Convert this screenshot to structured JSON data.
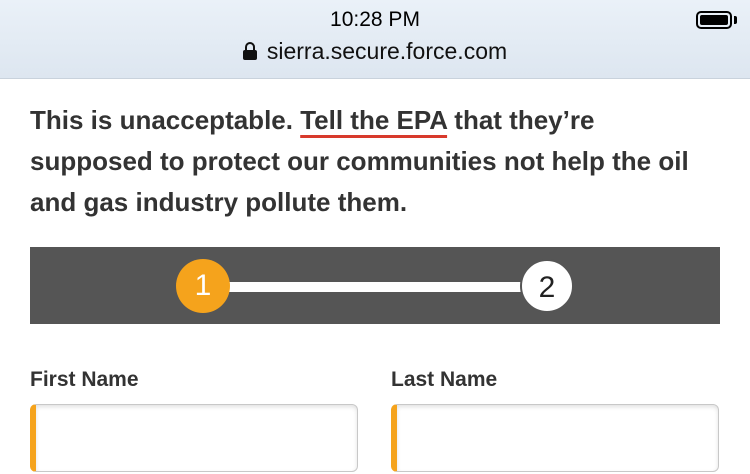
{
  "status_bar": {
    "time": "10:28 PM",
    "url": "sierra.secure.force.com",
    "battery_level": 1.0
  },
  "message": {
    "intro": "This is unacceptable. ",
    "link_text": "Tell the EPA",
    "rest": " that they’re supposed to protect our communities not help the oil and gas industry pollute them."
  },
  "stepper": {
    "steps": [
      "1",
      "2"
    ],
    "current_step": 1,
    "active_color": "#f5a31c"
  },
  "form": {
    "first_name_label": "First Name",
    "last_name_label": "Last Name",
    "first_name_value": "",
    "last_name_value": ""
  },
  "icons": [
    "lock-icon",
    "battery-icon"
  ]
}
